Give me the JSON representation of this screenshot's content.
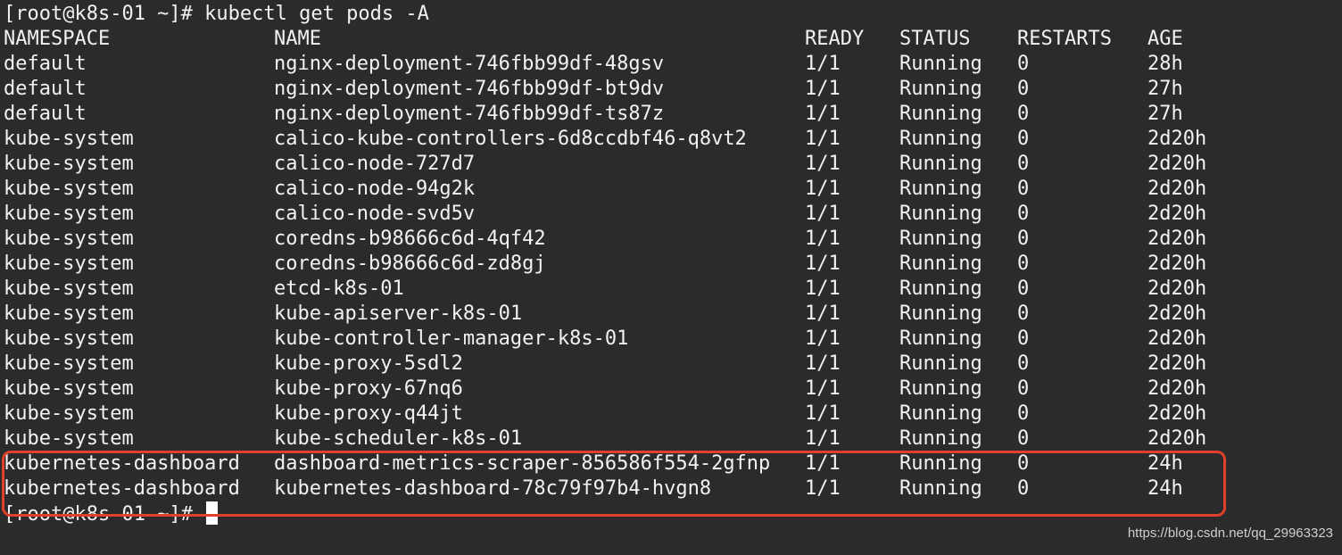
{
  "command_line": {
    "prompt": "[root@k8s-01 ~]#",
    "command": "kubectl get pods -A"
  },
  "table": {
    "headers": {
      "namespace": "NAMESPACE",
      "name": "NAME",
      "ready": "READY",
      "status": "STATUS",
      "restarts": "RESTARTS",
      "age": "AGE"
    },
    "rows": [
      {
        "namespace": "default",
        "name": "nginx-deployment-746fbb99df-48gsv",
        "ready": "1/1",
        "status": "Running",
        "restarts": "0",
        "age": "28h"
      },
      {
        "namespace": "default",
        "name": "nginx-deployment-746fbb99df-bt9dv",
        "ready": "1/1",
        "status": "Running",
        "restarts": "0",
        "age": "27h"
      },
      {
        "namespace": "default",
        "name": "nginx-deployment-746fbb99df-ts87z",
        "ready": "1/1",
        "status": "Running",
        "restarts": "0",
        "age": "27h"
      },
      {
        "namespace": "kube-system",
        "name": "calico-kube-controllers-6d8ccdbf46-q8vt2",
        "ready": "1/1",
        "status": "Running",
        "restarts": "0",
        "age": "2d20h"
      },
      {
        "namespace": "kube-system",
        "name": "calico-node-727d7",
        "ready": "1/1",
        "status": "Running",
        "restarts": "0",
        "age": "2d20h"
      },
      {
        "namespace": "kube-system",
        "name": "calico-node-94g2k",
        "ready": "1/1",
        "status": "Running",
        "restarts": "0",
        "age": "2d20h"
      },
      {
        "namespace": "kube-system",
        "name": "calico-node-svd5v",
        "ready": "1/1",
        "status": "Running",
        "restarts": "0",
        "age": "2d20h"
      },
      {
        "namespace": "kube-system",
        "name": "coredns-b98666c6d-4qf42",
        "ready": "1/1",
        "status": "Running",
        "restarts": "0",
        "age": "2d20h"
      },
      {
        "namespace": "kube-system",
        "name": "coredns-b98666c6d-zd8gj",
        "ready": "1/1",
        "status": "Running",
        "restarts": "0",
        "age": "2d20h"
      },
      {
        "namespace": "kube-system",
        "name": "etcd-k8s-01",
        "ready": "1/1",
        "status": "Running",
        "restarts": "0",
        "age": "2d20h"
      },
      {
        "namespace": "kube-system",
        "name": "kube-apiserver-k8s-01",
        "ready": "1/1",
        "status": "Running",
        "restarts": "0",
        "age": "2d20h"
      },
      {
        "namespace": "kube-system",
        "name": "kube-controller-manager-k8s-01",
        "ready": "1/1",
        "status": "Running",
        "restarts": "0",
        "age": "2d20h"
      },
      {
        "namespace": "kube-system",
        "name": "kube-proxy-5sdl2",
        "ready": "1/1",
        "status": "Running",
        "restarts": "0",
        "age": "2d20h"
      },
      {
        "namespace": "kube-system",
        "name": "kube-proxy-67nq6",
        "ready": "1/1",
        "status": "Running",
        "restarts": "0",
        "age": "2d20h"
      },
      {
        "namespace": "kube-system",
        "name": "kube-proxy-q44jt",
        "ready": "1/1",
        "status": "Running",
        "restarts": "0",
        "age": "2d20h"
      },
      {
        "namespace": "kube-system",
        "name": "kube-scheduler-k8s-01",
        "ready": "1/1",
        "status": "Running",
        "restarts": "0",
        "age": "2d20h"
      },
      {
        "namespace": "kubernetes-dashboard",
        "name": "dashboard-metrics-scraper-856586f554-2gfnp",
        "ready": "1/1",
        "status": "Running",
        "restarts": "0",
        "age": "24h"
      },
      {
        "namespace": "kubernetes-dashboard",
        "name": "kubernetes-dashboard-78c79f97b4-hvgn8",
        "ready": "1/1",
        "status": "Running",
        "restarts": "0",
        "age": "24h"
      }
    ]
  },
  "final_prompt": "[root@k8s-01 ~]#",
  "highlight_color": "#e0412d",
  "terminal_background": "#2b2b2b",
  "terminal_foreground": "#f2f2f2",
  "watermark": "https://blog.csdn.net/qq_29963323"
}
